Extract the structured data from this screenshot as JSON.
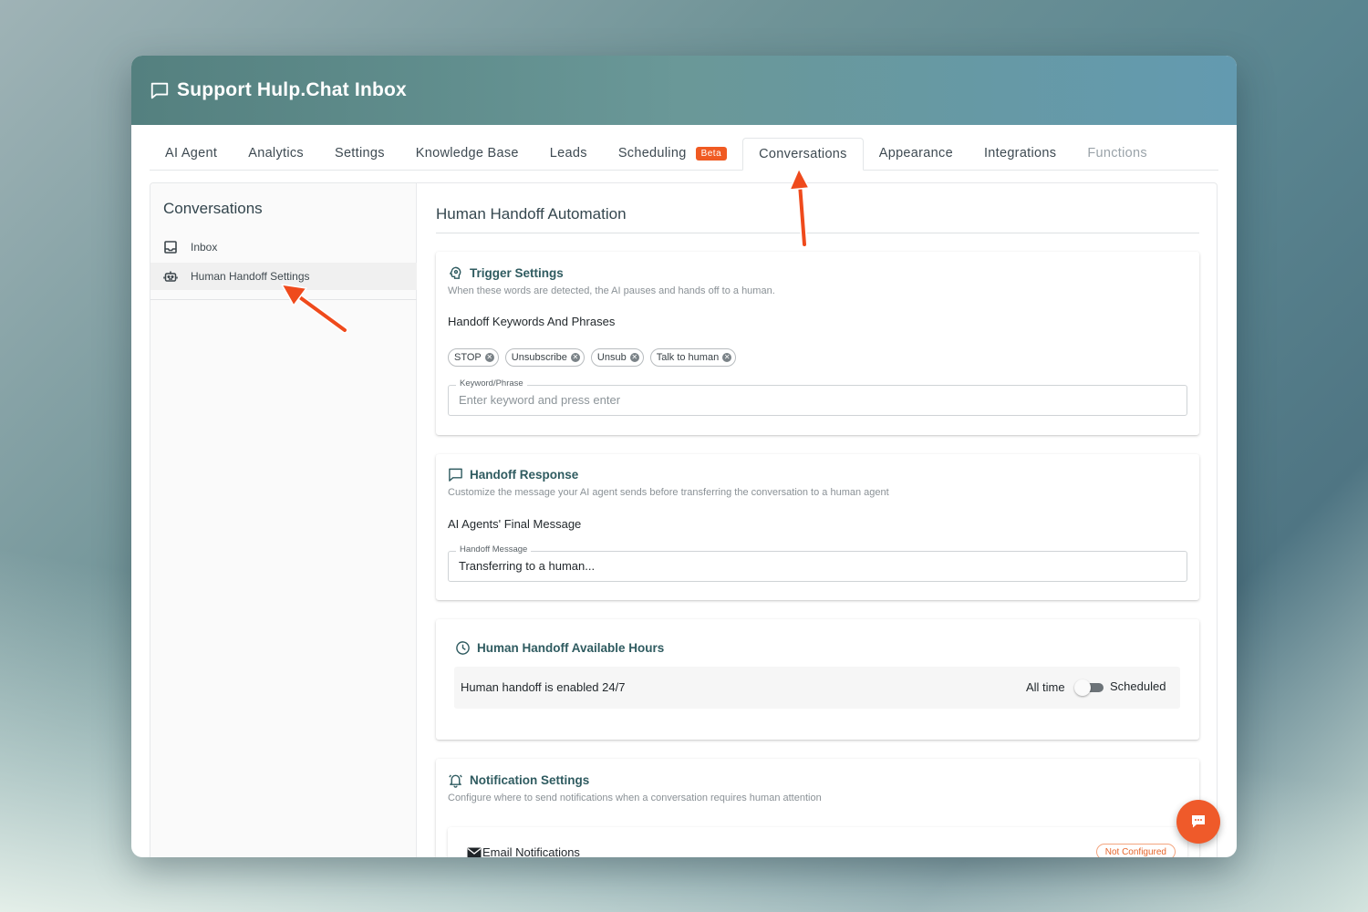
{
  "window": {
    "title": "Support Hulp.Chat Inbox"
  },
  "tabs": [
    {
      "label": "AI Agent"
    },
    {
      "label": "Analytics"
    },
    {
      "label": "Settings"
    },
    {
      "label": "Knowledge Base"
    },
    {
      "label": "Leads"
    },
    {
      "label": "Scheduling",
      "badge": "Beta"
    },
    {
      "label": "Conversations",
      "active": true
    },
    {
      "label": "Appearance"
    },
    {
      "label": "Integrations"
    },
    {
      "label": "Functions",
      "disabled": true
    }
  ],
  "sidebar": {
    "title": "Conversations",
    "items": [
      {
        "label": "Inbox",
        "icon": "inbox-icon"
      },
      {
        "label": "Human Handoff Settings",
        "icon": "robot-icon",
        "selected": true
      }
    ]
  },
  "main": {
    "title": "Human Handoff Automation",
    "trigger": {
      "heading": "Trigger Settings",
      "subtitle": "When these words are detected, the AI pauses and hands off to a human.",
      "label": "Handoff Keywords And Phrases",
      "keywords": [
        "STOP",
        "Unsubscribe",
        "Unsub",
        "Talk to human"
      ],
      "field_label": "Keyword/Phrase",
      "placeholder": "Enter keyword and press enter"
    },
    "response": {
      "heading": "Handoff Response",
      "subtitle": "Customize the message your AI agent sends before transferring the conversation to a human agent",
      "label": "AI Agents' Final Message",
      "field_label": "Handoff Message",
      "value": "Transferring to a human..."
    },
    "hours": {
      "heading": "Human Handoff Available Hours",
      "status": "Human handoff is enabled 24/7",
      "option_left": "All time",
      "option_right": "Scheduled"
    },
    "notifications": {
      "heading": "Notification Settings",
      "subtitle": "Configure where to send notifications when a conversation requires human attention",
      "email_label": "Email Notifications",
      "email_status": "Not Configured"
    }
  },
  "colors": {
    "accent": "#f05a22",
    "heading": "#2f5b60",
    "titlebar_start": "#54807f",
    "titlebar_end": "#639ab0"
  }
}
